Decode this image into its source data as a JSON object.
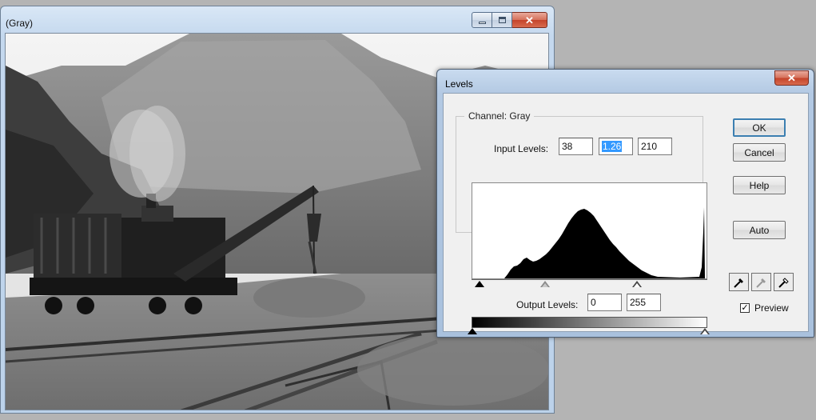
{
  "document_window": {
    "title": "(Gray)",
    "controls": {
      "minimize": "minimize-icon",
      "maximize": "maximize-icon",
      "close": "close-icon"
    }
  },
  "levels_dialog": {
    "title": "Levels",
    "channel_label": "Channel:",
    "channel_value": "Gray",
    "input_levels_label": "Input Levels:",
    "input_black": "38",
    "input_gamma": "1.26",
    "input_white": "210",
    "output_levels_label": "Output Levels:",
    "output_black": "0",
    "output_white": "255",
    "buttons": {
      "ok": "OK",
      "cancel": "Cancel",
      "help": "Help",
      "auto": "Auto"
    },
    "eyedroppers": [
      "black-eyedropper-icon",
      "gray-eyedropper-icon",
      "white-eyedropper-icon"
    ],
    "preview_label": "Preview",
    "preview_checked": true
  }
}
